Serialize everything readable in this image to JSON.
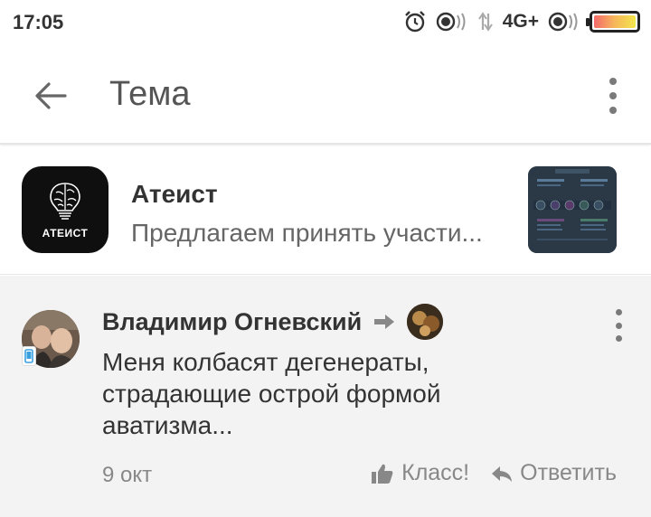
{
  "status_bar": {
    "time": "17:05",
    "network": "4G+",
    "icons": [
      "alarm-icon",
      "vibrate-icon",
      "signal-icon",
      "battery-icon"
    ]
  },
  "toolbar": {
    "title": "Тема",
    "back_icon": "arrow-left-icon",
    "more_icon": "more-vertical-icon"
  },
  "topic": {
    "group_logo_text": "АТЕИСТ",
    "name": "Атеист",
    "preview": "Предлагаем принять участи..."
  },
  "comment": {
    "author": "Владимир Огневский",
    "text_lines": [
      "Меня колбасят дегенераты,",
      "страдающие острой формой",
      "аватизма..."
    ],
    "date": "9 окт",
    "like_label": "Класс!",
    "reply_label": "Ответить"
  },
  "colors": {
    "background": "#ffffff",
    "comment_background": "#f3f3f3",
    "text_primary": "#333333",
    "text_secondary": "#888888",
    "battery_gradient": [
      "#f36a6a",
      "#f7b75b",
      "#f2e64d"
    ]
  }
}
